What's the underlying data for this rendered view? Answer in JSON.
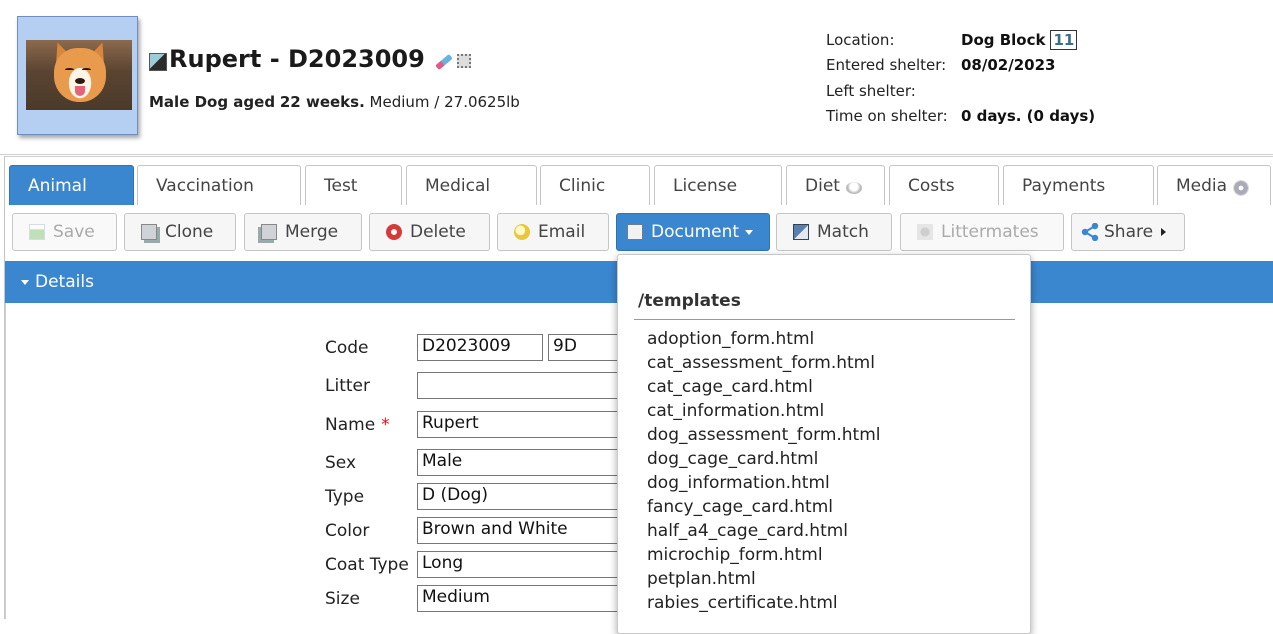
{
  "header": {
    "animal_name": "Rupert - D2023009",
    "subtitle_prefix": "Male Dog aged",
    "subtitle_age": "22 weeks.",
    "subtitle_suffix": "Medium / 27.0625lb",
    "location_label": "Location:",
    "location_value": "Dog Block",
    "location_unit": "11",
    "entered_label": "Entered shelter:",
    "entered_value": "08/02/2023",
    "left_label": "Left shelter:",
    "left_value": "",
    "time_label": "Time on shelter:",
    "time_value": "0 days. (0 days)"
  },
  "tabs": [
    {
      "label": "Animal",
      "active": true
    },
    {
      "label": "Vaccination"
    },
    {
      "label": "Test"
    },
    {
      "label": "Medical"
    },
    {
      "label": "Clinic"
    },
    {
      "label": "License"
    },
    {
      "label": "Diet",
      "icon": "diet-icon"
    },
    {
      "label": "Costs"
    },
    {
      "label": "Payments"
    },
    {
      "label": "Media",
      "icon": "disc-icon"
    }
  ],
  "toolbar": {
    "save": "Save",
    "clone": "Clone",
    "merge": "Merge",
    "delete": "Delete",
    "email": "Email",
    "document": "Document",
    "match": "Match",
    "littermates": "Littermates",
    "share": "Share"
  },
  "details": {
    "title": "Details",
    "code_label": "Code",
    "code_value": "D2023009",
    "short_code_value": "9D",
    "litter_label": "Litter",
    "litter_value": "",
    "name_label": "Name",
    "required_mark": "*",
    "name_value": "Rupert",
    "sex_label": "Sex",
    "sex_value": "Male",
    "type_label": "Type",
    "type_value": "D (Dog)",
    "color_label": "Color",
    "color_value": "Brown and White",
    "coat_label": "Coat Type",
    "coat_value": "Long",
    "size_label": "Size",
    "size_value": "Medium"
  },
  "document_menu": {
    "heading": "/templates",
    "items": [
      "adoption_form.html",
      "cat_assessment_form.html",
      "cat_cage_card.html",
      "cat_information.html",
      "dog_assessment_form.html",
      "dog_cage_card.html",
      "dog_information.html",
      "fancy_cage_card.html",
      "half_a4_cage_card.html",
      "microchip_form.html",
      "petplan.html",
      "rabies_certificate.html"
    ]
  },
  "colors": {
    "accent": "#3b87cf",
    "photo_frame": "#b5cff2",
    "required": "#dd1111"
  }
}
